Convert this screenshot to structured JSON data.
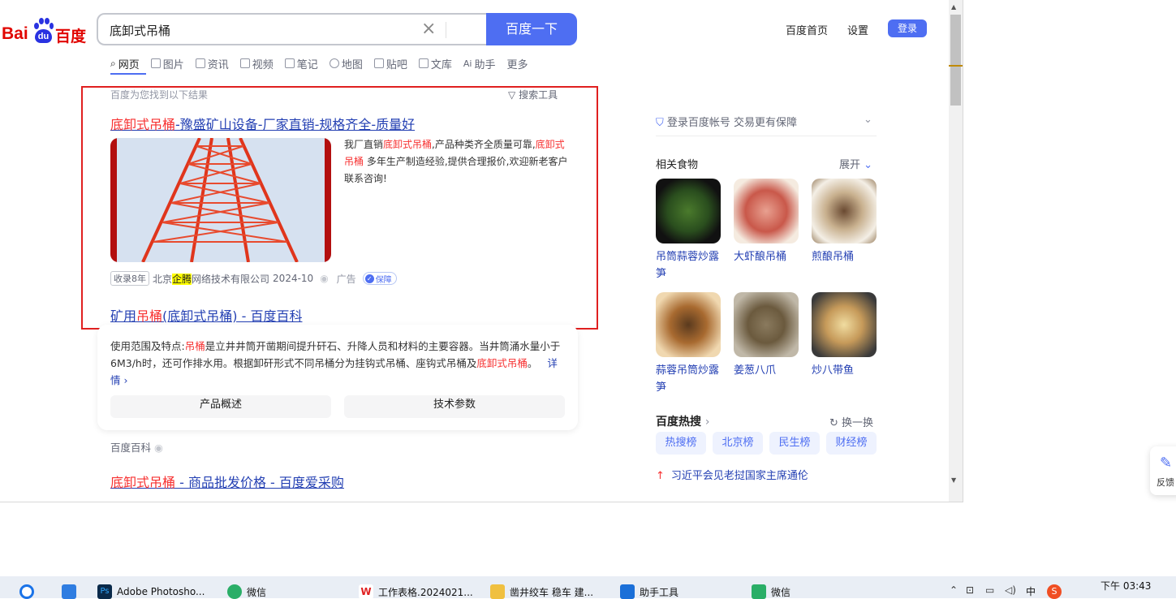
{
  "logo": {
    "text_left": "Bai",
    "paw_text": "du",
    "text_right": "百度"
  },
  "search": {
    "query": "底卸式吊桶",
    "clear": "×",
    "button": "百度一下"
  },
  "top_links": {
    "home": "百度首页",
    "settings": "设置",
    "login": "登录"
  },
  "tabs": [
    "网页",
    "图片",
    "资讯",
    "视频",
    "笔记",
    "地图",
    "贴吧",
    "文库",
    "助手",
    "更多"
  ],
  "results_header": {
    "found": "百度为您找到以下结果",
    "tools": "搜索工具"
  },
  "ad_result": {
    "title_hl": "底卸式吊桶",
    "title_rest": "-豫盛矿山设备-厂家直销-规格齐全-质量好",
    "desc_1": "我厂直销",
    "desc_hl1": "底卸式吊桶",
    "desc_2": ",产品种类齐全质量可靠,",
    "desc_hl2": "底卸式吊桶",
    "desc_3": " 多年生产制造经验,提供合理报价,欢迎新老客户联系咨询!",
    "badge": "收录8年",
    "company_1": "北京",
    "company_mark": "企腾",
    "company_2": "网络技术有限公司",
    "date": "2024-10",
    "ad_label": "广告",
    "bao": "保障"
  },
  "baike_result": {
    "title_1": "矿用",
    "title_hl": "吊桶",
    "title_2": "(底卸式吊桶) - 百度百科",
    "desc_1": "使用范围及特点:",
    "desc_hl1": "吊桶",
    "desc_2": "是立井井筒开凿期间提升矸石、升降人员和材料的主要容器。当井筒涌水量小于6M3/h时，还可作排水用。根据卸矸形式不同吊桶分为挂钩式吊桶、座钩式吊桶及",
    "desc_hl2": "底卸式吊桶",
    "desc_3": "。",
    "more": "详情 ›",
    "btn_overview": "产品概述",
    "btn_params": "技术参数",
    "source": "百度百科"
  },
  "third_result": {
    "title_hl": "底卸式吊桶",
    "title_rest": " - 商品批发价格 - 百度爱采购"
  },
  "sidebar": {
    "login_tip": "登录百度帐号 交易更有保障",
    "related_title": "相关食物",
    "expand": "展开",
    "foods": [
      {
        "name": "吊筒蒜蓉炒露笋",
        "color": "#2f5a23"
      },
      {
        "name": "大虾酿吊桶",
        "color": "#c9584a"
      },
      {
        "name": "煎酿吊桶",
        "color": "#b79a78"
      },
      {
        "name": "蒜蓉吊筒炒露笋",
        "color": "#8a5a2a"
      },
      {
        "name": "姜葱八爪",
        "color": "#6b5a3e"
      },
      {
        "name": "炒八带鱼",
        "color": "#c69a5a"
      }
    ],
    "hot_title": "百度热搜",
    "refresh": "换一换",
    "hot_tabs": [
      "热搜榜",
      "北京榜",
      "民生榜",
      "财经榜"
    ],
    "hot_item": "习近平会见老挝国家主席通伦"
  },
  "feedback": "反馈",
  "taskbar": {
    "apps": [
      "Adobe Photosho...",
      "微信",
      "工作表格.2024021...",
      "凿井绞车 稳车 建...",
      "助手工具",
      "微信"
    ],
    "time": "下午 03:43",
    "ime": "中"
  }
}
